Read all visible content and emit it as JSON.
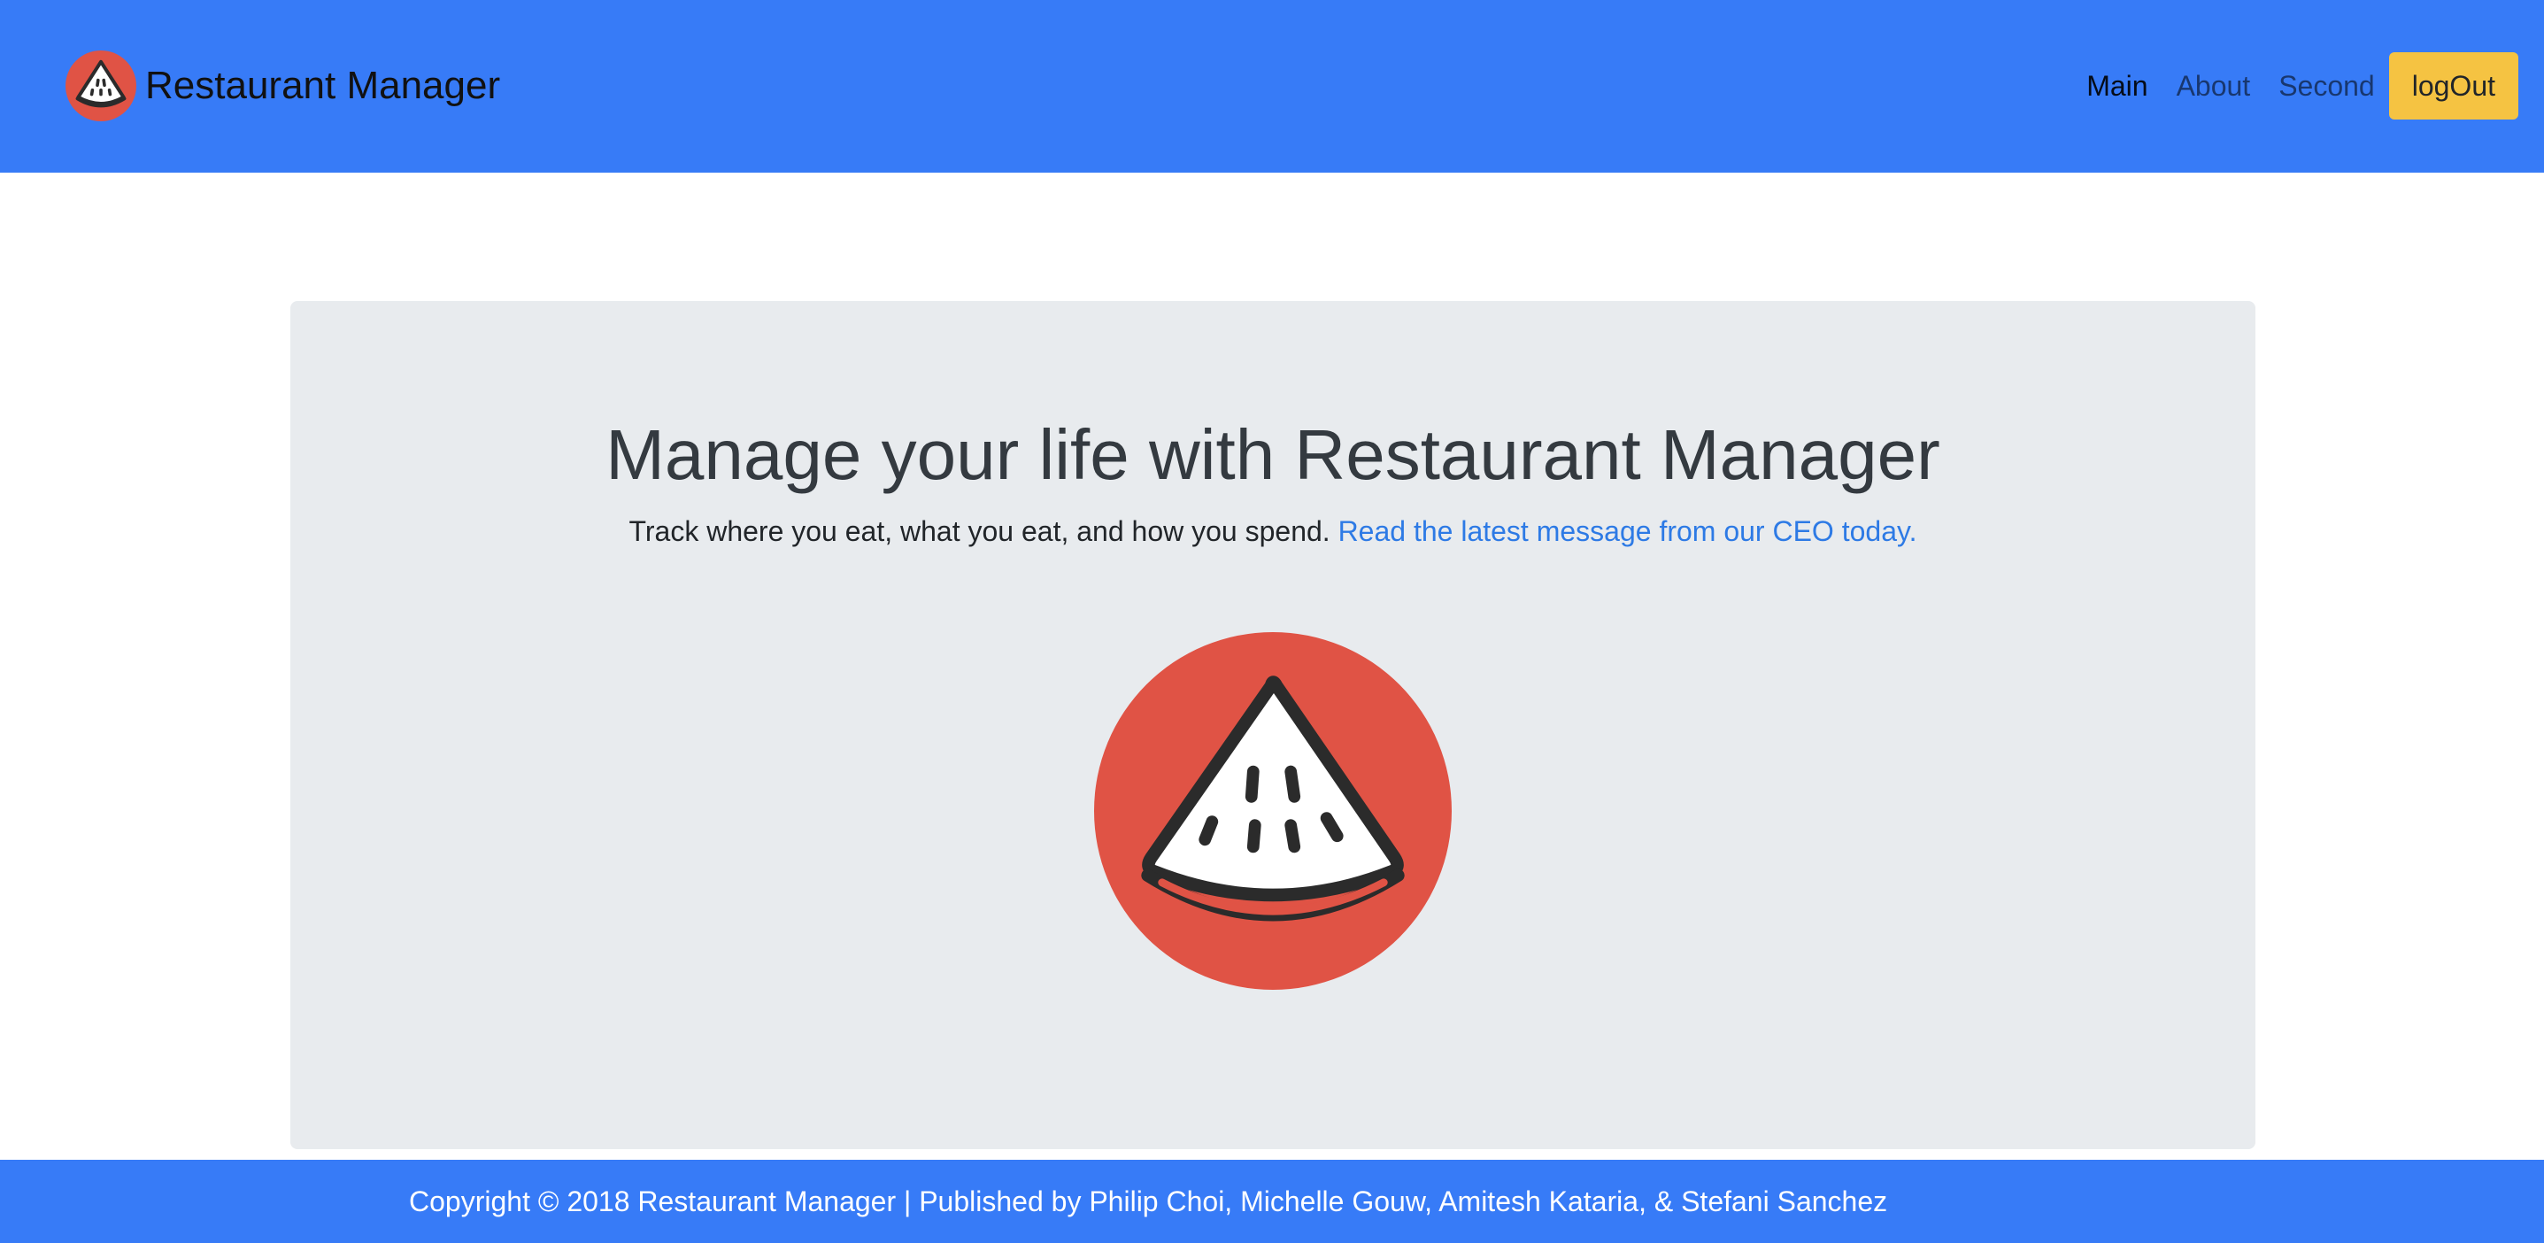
{
  "navbar": {
    "brand_title": "Restaurant Manager",
    "brand_icon": "watermelon-icon",
    "links": [
      {
        "label": "Main"
      },
      {
        "label": "About"
      },
      {
        "label": "Second"
      }
    ],
    "logout_label": "logOut"
  },
  "hero": {
    "title": "Manage your life with Restaurant Manager",
    "lead": "Track where you eat, what you eat, and how you spend. ",
    "link_text": "Read the latest message from our CEO today.",
    "logo_icon": "watermelon-icon"
  },
  "footer": {
    "text": "Copyright © 2018 Restaurant Manager | Published by Philip Choi, Michelle Gouw, Amitesh Kataria, & Stefani Sanchez"
  },
  "colors": {
    "navbar_bg": "#377bf7",
    "logout_bg": "#f5c342",
    "jumbotron_bg": "#e8ebee",
    "logo_red": "#e05345",
    "link_blue": "#2d7ae5"
  }
}
